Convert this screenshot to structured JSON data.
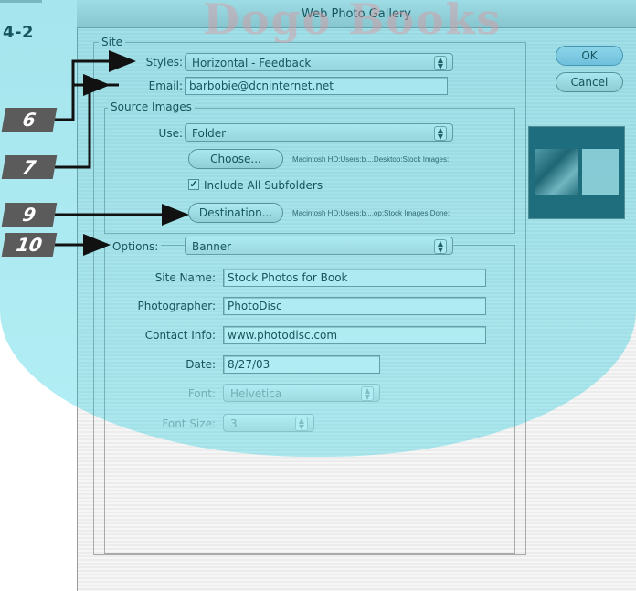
{
  "figure": {
    "label": "4-2"
  },
  "watermark": {
    "text": "Dogo Books"
  },
  "window": {
    "title": "Web Photo Gallery"
  },
  "site": {
    "group_label": "Site",
    "styles": {
      "label": "Styles:",
      "value": "Horizontal - Feedback"
    },
    "email": {
      "label": "Email:",
      "value": "barbobie@dcninternet.net"
    }
  },
  "source": {
    "group_label": "Source Images",
    "use": {
      "label": "Use:",
      "value": "Folder"
    },
    "choose_button": "Choose...",
    "choose_path": "Macintosh HD:Users:b....Desktop:Stock Images:",
    "include_subfolders": {
      "label": "Include All Subfolders",
      "checked": true
    },
    "destination_button": "Destination...",
    "destination_path": "Macintosh HD:Users:b....op:Stock Images Done:"
  },
  "options": {
    "label": "Options:",
    "value": "Banner",
    "site_name": {
      "label": "Site Name:",
      "value": "Stock Photos for Book"
    },
    "photographer": {
      "label": "Photographer:",
      "value": "PhotoDisc"
    },
    "contact_info": {
      "label": "Contact Info:",
      "value": "www.photodisc.com"
    },
    "date": {
      "label": "Date:",
      "value": "8/27/03"
    },
    "font": {
      "label": "Font:",
      "value": "Helvetica"
    },
    "font_size": {
      "label": "Font Size:",
      "value": "3"
    }
  },
  "buttons": {
    "ok": "OK",
    "cancel": "Cancel"
  },
  "callouts": [
    "6",
    "7",
    "9",
    "10"
  ],
  "colors": {
    "callout_bg": "#5b5b5b",
    "watermark_band": "#00c8dc",
    "ok_button": "#a8c4e4"
  }
}
